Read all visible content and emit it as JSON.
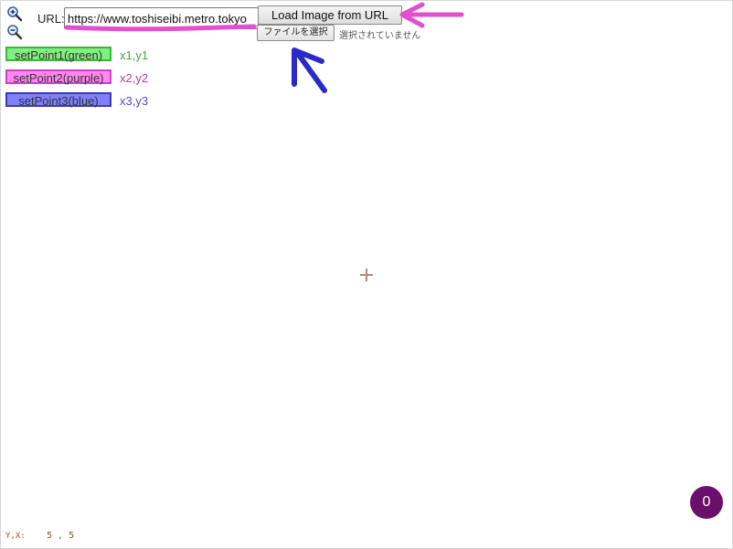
{
  "toolbar": {
    "zoom_in_icon": "zoom-in-icon",
    "zoom_out_icon": "zoom-out-icon",
    "url_label": "URL:",
    "url_value": "https://www.toshiseibi.metro.tokyo",
    "load_button": "Load Image from URL",
    "file_button": "ファイルを選択",
    "file_status": "選択されていません"
  },
  "points": [
    {
      "button": "setPoint1(green)",
      "coords": "x1,y1",
      "color": "#80f080"
    },
    {
      "button": "setPoint2(purple)",
      "coords": "x2,y2",
      "color": "#ff88f0"
    },
    {
      "button": "setPoint3(blue)",
      "coords": "x3,y3",
      "color": "#8080ff"
    }
  ],
  "canvas": {
    "crosshair_icon": "crosshair-icon"
  },
  "status": {
    "yx_label": "Y,X:",
    "yx_value": "5 , 5"
  },
  "badge": {
    "count": "0",
    "color": "#6a0f6a"
  },
  "annotations": {
    "underline_color": "#e050d0",
    "arrow_pink_color": "#e050d0",
    "arrow_blue_color": "#2a2ac8"
  }
}
